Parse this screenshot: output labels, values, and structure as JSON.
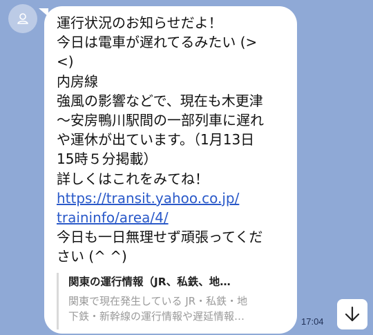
{
  "message": {
    "lines": [
      "運行状況のお知らせだよ！",
      "今日は電車が遅れてるみたい (>",
      "<)",
      "内房線",
      "強風の影響などで、現在も木更津",
      "〜安房鴨川駅間の一部列車に遅れ",
      "や運休が出ています。（1月13日",
      "15時５分掲載）",
      "詳しくはこれをみてね！"
    ],
    "link_lines": [
      "https://transit.yahoo.co.jp/",
      "traininfo/area/4/"
    ],
    "closing_lines": [
      "今日も一日無理せず頑張ってくだ",
      "さい (^ ^)"
    ]
  },
  "preview": {
    "title": "関東の運行情報（JR、私鉄、地…",
    "description_lines": [
      "関東で現在発生している JR・私鉄・地",
      "下鉄・新幹線の運行情報や遅延情報…"
    ]
  },
  "timestamp": "17:04",
  "icons": {
    "avatar": "user-icon",
    "scroll": "arrow-down-icon"
  },
  "colors": {
    "background": "#8fa9d6",
    "bubble": "#ffffff",
    "link": "#2a59c9"
  }
}
